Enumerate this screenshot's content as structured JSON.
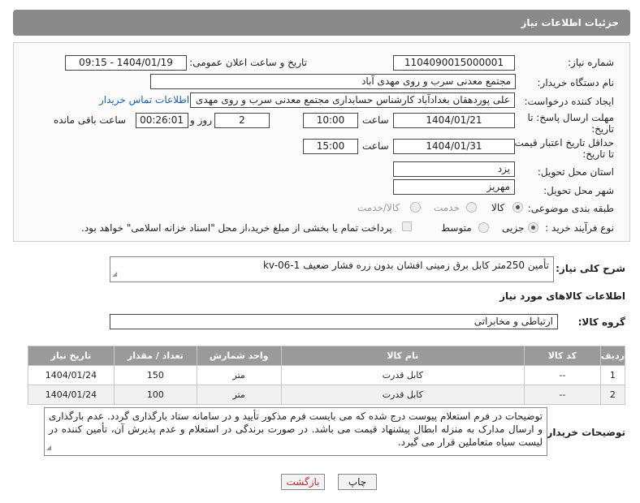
{
  "header": {
    "title": "جزئیات اطلاعات نیاز"
  },
  "form": {
    "need_number": {
      "label": "شماره نیاز:",
      "value": "1104090015000001"
    },
    "announce_datetime": {
      "label": "تاریخ و ساعت اعلان عمومی:",
      "value": "1404/01/19 - 09:15"
    },
    "buyer_org": {
      "label": "نام دستگاه خریدار:",
      "value": "مجتمع معدنی سرب و روی مهدی آباد"
    },
    "requester": {
      "label": "ایجاد کننده درخواست:",
      "value": "علی پوردهقان بغدادآباد کارشناس حسابداری مجتمع معدنی سرب و روی مهدی",
      "link": "اطلاعات تماس خریدار"
    },
    "reply_deadline": {
      "label1": "مهلت ارسال پاسخ: تا",
      "label2": "تاریخ:",
      "date": "1404/01/21",
      "time_label": "ساعت",
      "time": "10:00",
      "days": "2",
      "days_label": "روز و",
      "remaining": "00:26:01",
      "remaining_label": "ساعت باقی مانده"
    },
    "price_validity": {
      "label1": "حداقل تاریخ اعتبار قیمت:",
      "label2": "تا تاریخ:",
      "date": "1404/01/31",
      "time_label": "ساعت",
      "time": "15:00"
    },
    "province": {
      "label": "استان محل تحویل:",
      "value": "یزد"
    },
    "city": {
      "label": "شهر محل تحویل:",
      "value": "مهریز"
    },
    "category": {
      "label": "طبقه بندی موضوعی:",
      "options": [
        "کالا",
        "خدمت",
        "کالا/خدمت"
      ],
      "selected": "کالا"
    },
    "purchase_type": {
      "label": "نوع فرآیند خرید :",
      "options": [
        "جزیی",
        "متوسط"
      ],
      "selected": "جزیی",
      "note": "پرداخت تمام یا بخشی از مبلغ خرید،از محل \"اسناد خزانه اسلامی\" خواهد بود."
    }
  },
  "description": {
    "label": "شرح کلی نیاز:",
    "value": "تأمین 250متر کابل برق زمینی افشان بدون زره فشار ضعیف kv-06-1"
  },
  "goods_section": {
    "title": "اطلاعات کالاهای مورد نیاز",
    "group_label": "گروه کالا:",
    "group_value": "ارتباطی و مخابراتی",
    "columns": [
      "ردیف",
      "کد کالا",
      "نام کالا",
      "واحد شمارش",
      "تعداد / مقدار",
      "تاریخ نیاز"
    ],
    "rows": [
      [
        "1",
        "--",
        "کابل قدرت",
        "متر",
        "150",
        "1404/01/24"
      ],
      [
        "2",
        "--",
        "کابل قدرت",
        "متر",
        "100",
        "1404/01/24"
      ]
    ]
  },
  "buyer_notes": {
    "label": "توضیحات خریدار:",
    "value": "توضیحات در فرم استعلام پیوست درج شده که می بایست فرم مذکور تأیید و در سامانه ستاد بارگذاری گردد. عدم بارگذاری و ارسال مدارک به منزله ابطال پیشنهاد قیمت می باشد. در صورت برندگی در استعلام و عدم پذیرش آن، تأمین کننده در لیست سیاه متعاملین قرار می گیرد."
  },
  "buttons": {
    "print": "چاپ",
    "back": "بازگشت"
  },
  "colors": {
    "header_bg": "#8a8a8a",
    "table_header_bg": "#9a9a9a",
    "link": "#1a5fb4",
    "back_button_text": "#c0282e"
  }
}
